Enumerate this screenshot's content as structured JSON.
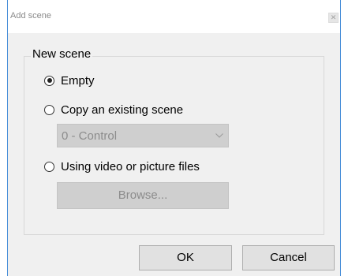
{
  "window": {
    "title": "Add scene",
    "close_glyph": "✕"
  },
  "group": {
    "label": "New scene"
  },
  "options": {
    "empty": {
      "label": "Empty",
      "checked": true
    },
    "copy_existing": {
      "label": "Copy an existing scene",
      "checked": false
    },
    "using_files": {
      "label": "Using video or picture files",
      "checked": false
    }
  },
  "scene_select": {
    "value": "0 - Control",
    "disabled": true
  },
  "browse_button": {
    "label": "Browse...",
    "disabled": true
  },
  "buttons": {
    "ok": "OK",
    "cancel": "Cancel"
  },
  "icons": {
    "close": "close-icon",
    "dropdown": "chevron-down-icon"
  },
  "colors": {
    "window_border": "#4a90d9",
    "disabled_bg": "#cfcfcf",
    "button_bg": "#e1e1e1"
  }
}
